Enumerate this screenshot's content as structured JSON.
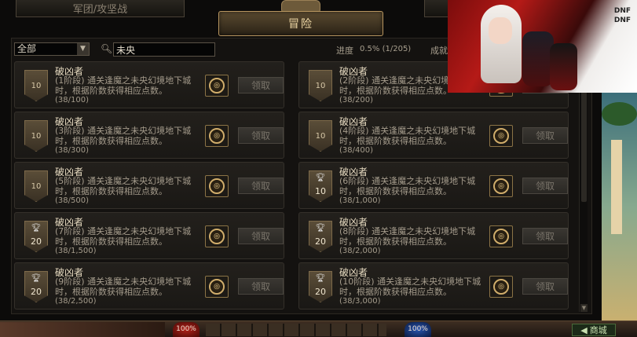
{
  "tabs": {
    "left": "军团/攻坚战",
    "active": "冒险"
  },
  "filter": {
    "category": "全部",
    "search_value": "未央"
  },
  "progress": {
    "label": "进度",
    "value": "0.5% (1/205)",
    "achievement_label": "成就"
  },
  "claim_label": "领取",
  "cards": [
    {
      "title": "破凶者",
      "desc": "(1阶段) 通关逢魔之未央幻境地下城时，根据阶数获得相应点数。",
      "progress": "(38/100)",
      "badge": "10",
      "trophy": false
    },
    {
      "title": "破凶者",
      "desc": "(2阶段) 通关逢魔之未央幻境地下城时，根据阶数获得相应点数。",
      "progress": "(38/200)",
      "badge": "10",
      "trophy": false
    },
    {
      "title": "破凶者",
      "desc": "(3阶段) 通关逢魔之未央幻境地下城时，根据阶数获得相应点数。",
      "progress": "(38/300)",
      "badge": "10",
      "trophy": false
    },
    {
      "title": "破凶者",
      "desc": "(4阶段) 通关逢魔之未央幻境地下城时，根据阶数获得相应点数。",
      "progress": "(38/400)",
      "badge": "10",
      "trophy": false
    },
    {
      "title": "破凶者",
      "desc": "(5阶段) 通关逢魔之未央幻境地下城时，根据阶数获得相应点数。",
      "progress": "(38/500)",
      "badge": "10",
      "trophy": false
    },
    {
      "title": "破凶者",
      "desc": "(6阶段) 通关逢魔之未央幻境地下城时，根据阶数获得相应点数。",
      "progress": "(38/1,000)",
      "badge": "10",
      "trophy": true
    },
    {
      "title": "破凶者",
      "desc": "(7阶段) 通关逢魔之未央幻境地下城时，根据阶数获得相应点数。",
      "progress": "(38/1,500)",
      "badge": "20",
      "trophy": true
    },
    {
      "title": "破凶者",
      "desc": "(8阶段) 通关逢魔之未央幻境地下城时，根据阶数获得相应点数。",
      "progress": "(38/2,000)",
      "badge": "20",
      "trophy": true
    },
    {
      "title": "破凶者",
      "desc": "(9阶段) 通关逢魔之未央幻境地下城时，根据阶数获得相应点数。",
      "progress": "(38/2,500)",
      "badge": "20",
      "trophy": true
    },
    {
      "title": "破凶者",
      "desc": "(10阶段) 通关逢魔之未央幻境地下城时，根据阶数获得相应点数。",
      "progress": "(38/3,000)",
      "badge": "20",
      "trophy": true
    }
  ],
  "hud": {
    "hp": "100%",
    "mp": "100%",
    "shop": "商城"
  },
  "colors": {
    "accent": "#b89660",
    "panel": "#141210",
    "claim_disabled": "#7a746a"
  }
}
